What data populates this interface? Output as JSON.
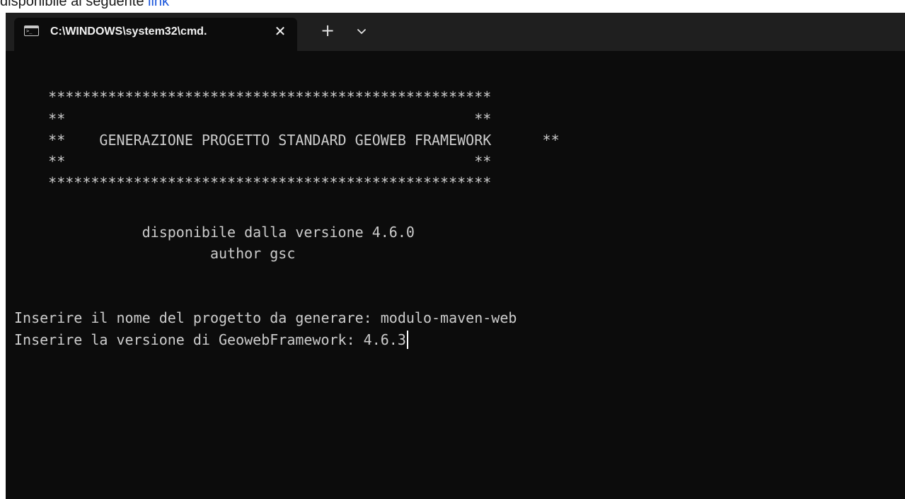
{
  "caption": {
    "text": "disponibile al seguente ",
    "link": "link"
  },
  "window": {
    "tab_title": "C:\\WINDOWS\\system32\\cmd.",
    "tab_icon": "terminal-icon",
    "close_icon": "close-icon",
    "new_tab_icon": "plus-icon",
    "dropdown_icon": "chevron-down-icon"
  },
  "console": {
    "lines": [
      "    ****************************************************",
      "    **                                                **",
      "    **    GENERAZIONE PROGETTO STANDARD GEOWEB FRAMEWORK      **",
      "    **                                                **",
      "    ****************************************************",
      "",
      "               disponibile dalla versione 4.6.0",
      "                       author gsc",
      "",
      "",
      "Inserire il nome del progetto da generare: modulo-maven-web",
      "Inserire la versione di GeowebFramework: 4.6.3"
    ]
  },
  "colors": {
    "terminal_bg": "#0c0c0c",
    "tabbar_bg": "#1f1f1f",
    "text": "#cccccc"
  }
}
